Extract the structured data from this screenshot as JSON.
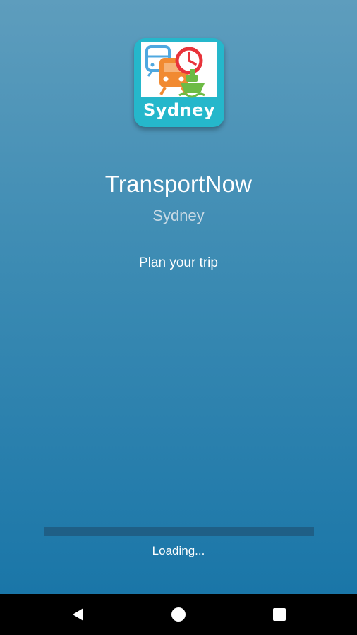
{
  "splash": {
    "icon": {
      "name": "transportnow-app-icon",
      "label": "Sydney",
      "background_color": "#25b7cb"
    },
    "title": "TransportNow",
    "subtitle": "Sydney",
    "tagline": "Plan your trip"
  },
  "loading": {
    "text": "Loading...",
    "progress": 0
  },
  "navigation_bar": {
    "back_icon": "back-triangle-icon",
    "home_icon": "home-circle-icon",
    "recents_icon": "recents-square-icon"
  },
  "colors": {
    "background_top": "#5e9dbd",
    "background_bottom": "#1a76a8",
    "progress_track": "#1f5f86",
    "navbar": "#000000"
  }
}
